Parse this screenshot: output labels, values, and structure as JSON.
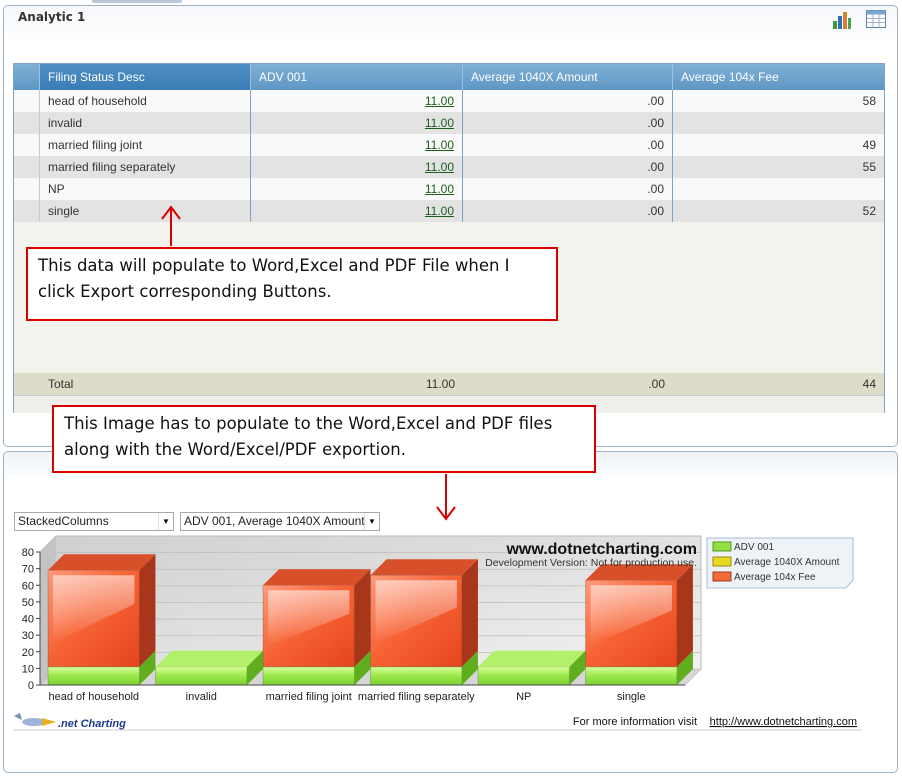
{
  "panel1": {
    "title": "Analytic 1",
    "icons": {
      "chart": "bar-chart-icon",
      "grid": "grid-table-icon"
    }
  },
  "grid": {
    "columns": [
      "Filing Status Desc",
      "ADV 001",
      "Average 1040X Amount",
      "Average 104x Fee"
    ],
    "rows": [
      {
        "status": "head of household",
        "adv": "11.00",
        "amount": ".00",
        "fee": "58"
      },
      {
        "status": "invalid",
        "adv": "11.00",
        "amount": ".00",
        "fee": ""
      },
      {
        "status": "married filing joint",
        "adv": "11.00",
        "amount": ".00",
        "fee": "49"
      },
      {
        "status": "married filing separately",
        "adv": "11.00",
        "amount": ".00",
        "fee": "55"
      },
      {
        "status": "NP",
        "adv": "11.00",
        "amount": ".00",
        "fee": ""
      },
      {
        "status": "single",
        "adv": "11.00",
        "amount": ".00",
        "fee": "52"
      }
    ],
    "total": {
      "label": "Total",
      "adv": "11.00",
      "amount": ".00",
      "fee": "44"
    }
  },
  "notes": {
    "note1": "This data will populate to Word,Excel and PDF File when I click Export corresponding Buttons.",
    "note2": "This Image has to populate to the Word,Excel and PDF files along with the Word/Excel/PDF exportion."
  },
  "chart_panel": {
    "type_select": "StackedColumns",
    "series_select": "ADV 001, Average 1040X Amount,",
    "watermark_title": "www.dotnetcharting.com",
    "watermark_sub": "Development Version: Not for production use.",
    "footer_logo": ".net Charting",
    "footer_info": "For more information visit",
    "footer_link": "http://www.dotnetcharting.com"
  },
  "colors": {
    "grid_header": "#6ca3cf",
    "adv": "#8fe040",
    "amount": "#e8d820",
    "fee": "#f06a3a",
    "annotation": "#d90000"
  },
  "chart_data": {
    "type": "bar",
    "stacked": true,
    "categories": [
      "head of household",
      "invalid",
      "married filing joint",
      "married filing separately",
      "NP",
      "single"
    ],
    "series": [
      {
        "name": "ADV 001",
        "values": [
          11,
          11,
          11,
          11,
          11,
          11
        ]
      },
      {
        "name": "Average 1040X Amount",
        "values": [
          0,
          0,
          0,
          0,
          0,
          0
        ]
      },
      {
        "name": "Average 104x Fee",
        "values": [
          58,
          0,
          49,
          55,
          0,
          52
        ]
      }
    ],
    "yticks": [
      0,
      10,
      20,
      30,
      40,
      50,
      60,
      70,
      80
    ],
    "ylim": [
      0,
      80
    ],
    "grid": true,
    "legend": "top-right"
  }
}
